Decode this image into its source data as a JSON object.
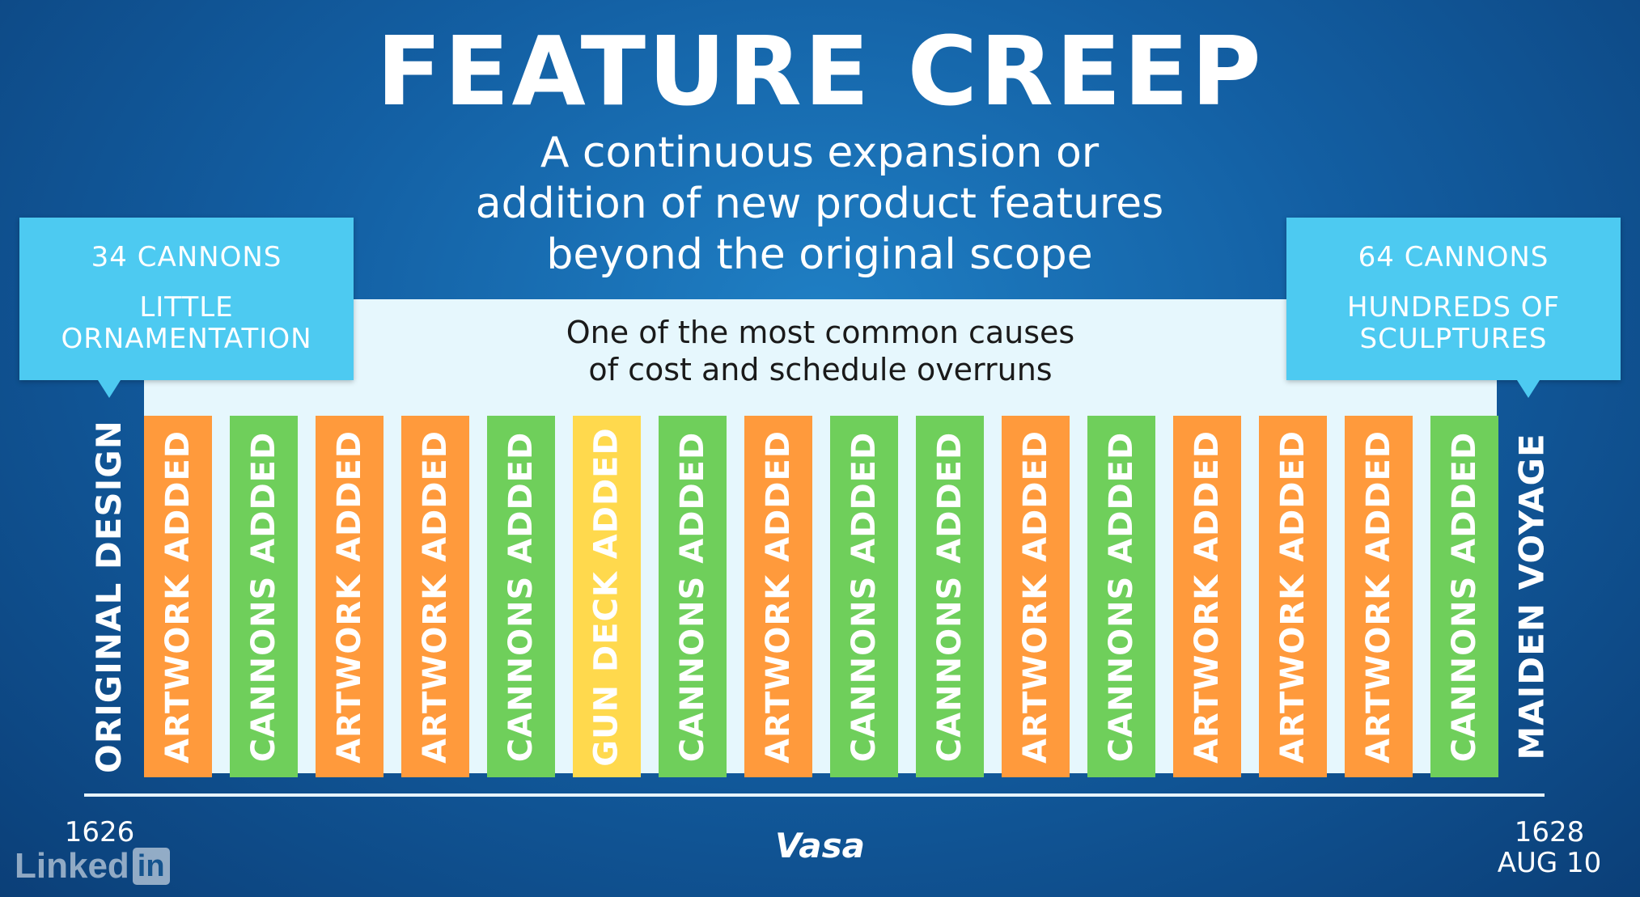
{
  "title": "FEATURE CREEP",
  "subtitle": [
    "A continuous expansion or",
    "addition of new product features",
    "beyond the original scope"
  ],
  "panel_text": [
    "One of the most common causes",
    "of cost and schedule overruns"
  ],
  "callout_left": {
    "line1": "34 CANNONS",
    "line2": [
      "LITTLE",
      "ORNAMENTATION"
    ]
  },
  "callout_right": {
    "line1": "64 CANNONS",
    "line2": [
      "HUNDREDS OF",
      "SCULPTURES"
    ]
  },
  "start_label": "ORIGINAL DESIGN",
  "end_label": "MAIDEN VOYAGE",
  "colors": {
    "artwork": "#ff9a3c",
    "cannons": "#6fcf5b",
    "gundeck": "#ffd94d",
    "callout": "#4dcaf1",
    "panel": "#e6f7fd"
  },
  "changes": [
    {
      "label": "ARTWORK ADDED",
      "type": "artwork"
    },
    {
      "label": "CANNONS ADDED",
      "type": "cannons"
    },
    {
      "label": "ARTWORK ADDED",
      "type": "artwork"
    },
    {
      "label": "ARTWORK ADDED",
      "type": "artwork"
    },
    {
      "label": "CANNONS ADDED",
      "type": "cannons"
    },
    {
      "label": "GUN DECK ADDED",
      "type": "gundeck"
    },
    {
      "label": "CANNONS ADDED",
      "type": "cannons"
    },
    {
      "label": "ARTWORK ADDED",
      "type": "artwork"
    },
    {
      "label": "CANNONS ADDED",
      "type": "cannons"
    },
    {
      "label": "CANNONS ADDED",
      "type": "cannons"
    },
    {
      "label": "ARTWORK ADDED",
      "type": "artwork"
    },
    {
      "label": "CANNONS ADDED",
      "type": "cannons"
    },
    {
      "label": "ARTWORK ADDED",
      "type": "artwork"
    },
    {
      "label": "ARTWORK ADDED",
      "type": "artwork"
    },
    {
      "label": "ARTWORK ADDED",
      "type": "artwork"
    },
    {
      "label": "CANNONS ADDED",
      "type": "cannons"
    }
  ],
  "timeline": {
    "start_year": "1626",
    "end_year": "1628",
    "end_date": "AUG 10",
    "vessel": "Vasa"
  },
  "brand": {
    "word": "Linked",
    "box": "in"
  }
}
